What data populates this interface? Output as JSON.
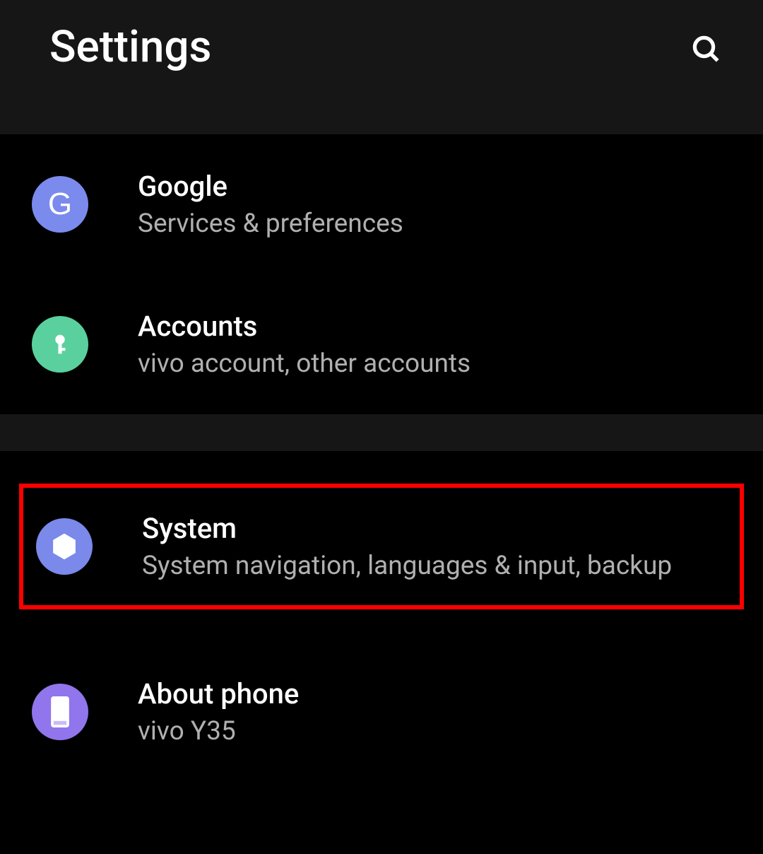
{
  "header": {
    "title": "Settings"
  },
  "items": [
    {
      "title": "Google",
      "subtitle": "Services & preferences",
      "icon_letter": "G"
    },
    {
      "title": "Accounts",
      "subtitle": "vivo account, other accounts"
    },
    {
      "title": "System",
      "subtitle": "System navigation, languages & input, backup"
    },
    {
      "title": "About phone",
      "subtitle": "vivo Y35"
    }
  ]
}
